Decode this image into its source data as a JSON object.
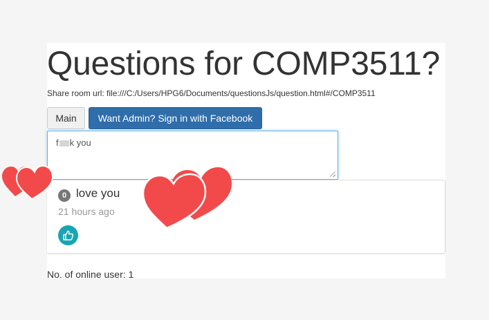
{
  "room": {
    "title": "Questions for COMP3511?",
    "share_label": "Share room url: file:///C:/Users/HPG6/Documents/questionsJs/question.html#/COMP3511"
  },
  "toolbar": {
    "main_label": "Main",
    "admin_label": "Want Admin? Sign in with Facebook"
  },
  "composer": {
    "text_prefix": "f",
    "text_suffix": "k you"
  },
  "questions": [
    {
      "likes": "0",
      "text": "love you",
      "time": "21 hours ago",
      "like_icon": "thumbs-up-icon"
    }
  ],
  "footer": {
    "online_users": "No. of online user: 1"
  },
  "colors": {
    "admin_button": "#2f6eaa",
    "like_button": "#1aa4b3",
    "heart": "#f24a4a",
    "badge": "#777777"
  },
  "decorations": [
    "heart-icon",
    "heart-icon"
  ]
}
